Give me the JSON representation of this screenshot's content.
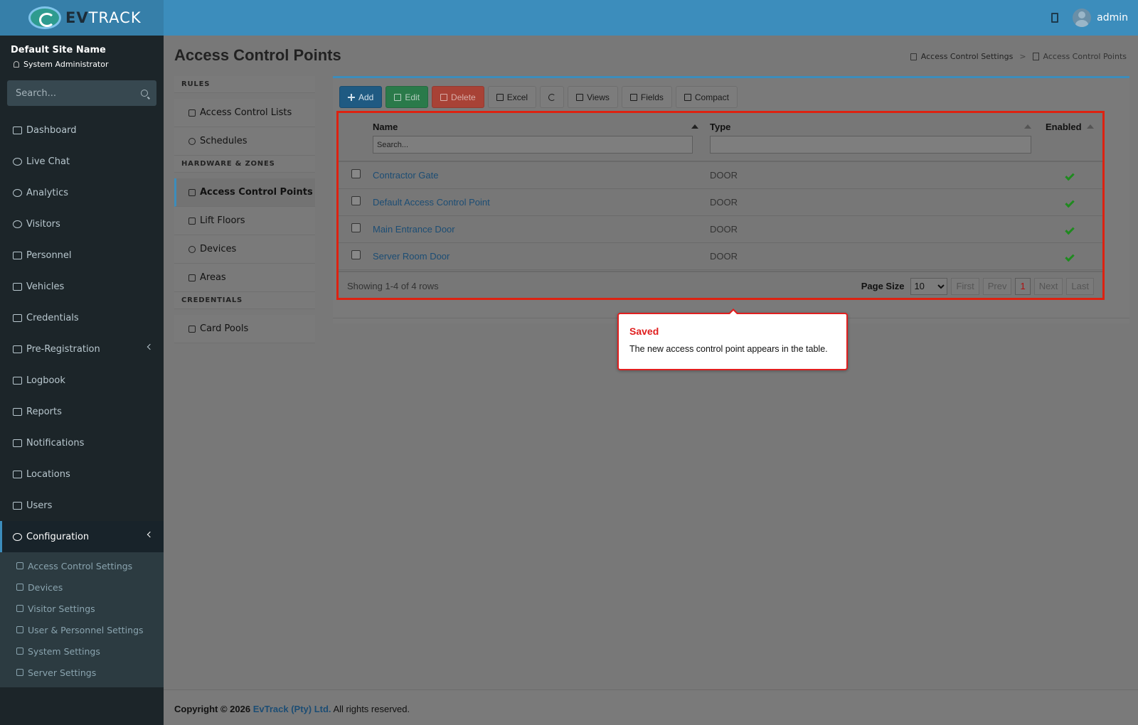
{
  "header": {
    "brand_ev": "EV",
    "brand_track": "TRACK",
    "user": "admin"
  },
  "sidebar": {
    "site_name": "Default Site Name",
    "role": "System Administrator",
    "search_placeholder": "Search...",
    "items": [
      {
        "label": "Dashboard",
        "icon": "dashboard-icon"
      },
      {
        "label": "Live Chat",
        "icon": "headset-icon"
      },
      {
        "label": "Analytics",
        "icon": "analytics-icon"
      },
      {
        "label": "Visitors",
        "icon": "eye-icon"
      },
      {
        "label": "Personnel",
        "icon": "personnel-icon"
      },
      {
        "label": "Vehicles",
        "icon": "car-icon"
      },
      {
        "label": "Credentials",
        "icon": "id-card-icon"
      },
      {
        "label": "Pre-Registration",
        "icon": "exchange-icon"
      },
      {
        "label": "Logbook",
        "icon": "book-icon"
      },
      {
        "label": "Reports",
        "icon": "chart-icon"
      },
      {
        "label": "Notifications",
        "icon": "bell-icon"
      },
      {
        "label": "Locations",
        "icon": "building-icon"
      },
      {
        "label": "Users",
        "icon": "users-icon"
      },
      {
        "label": "Configuration",
        "icon": "gear-icon"
      }
    ],
    "submenu": [
      {
        "label": "Access Control Settings",
        "icon": "lock-icon"
      },
      {
        "label": "Devices",
        "icon": "chip-icon"
      },
      {
        "label": "Visitor Settings",
        "icon": "eye-icon"
      },
      {
        "label": "User & Personnel Settings",
        "icon": "user-cog-icon"
      },
      {
        "label": "System Settings",
        "icon": "sliders-icon"
      },
      {
        "label": "Server Settings",
        "icon": "server-icon"
      }
    ]
  },
  "page": {
    "title": "Access Control Points",
    "breadcrumb": [
      "Access Control Settings",
      "Access Control Points"
    ]
  },
  "subnav": {
    "sections": [
      {
        "header": "RULES",
        "items": [
          "Access Control Lists",
          "Schedules"
        ]
      },
      {
        "header": "HARDWARE & ZONES",
        "items": [
          "Access Control Points",
          "Lift Floors",
          "Devices",
          "Areas"
        ]
      },
      {
        "header": "CREDENTIALS",
        "items": [
          "Card Pools"
        ]
      }
    ]
  },
  "toolbar": {
    "add": "Add",
    "edit": "Edit",
    "delete": "Delete",
    "excel": "Excel",
    "views": "Views",
    "fields": "Fields",
    "compact": "Compact"
  },
  "table": {
    "columns": [
      "Name",
      "Type",
      "Enabled"
    ],
    "name_filter_placeholder": "Search...",
    "rows": [
      {
        "name": "Contractor Gate",
        "type": "DOOR",
        "enabled": true
      },
      {
        "name": "Default Access Control Point",
        "type": "DOOR",
        "enabled": true
      },
      {
        "name": "Main Entrance Door",
        "type": "DOOR",
        "enabled": true
      },
      {
        "name": "Server Room Door",
        "type": "DOOR",
        "enabled": true
      }
    ],
    "showing": "Showing 1-4 of 4 rows",
    "page_size_label": "Page Size",
    "page_size": "10",
    "first": "First",
    "prev": "Prev",
    "current_page": "1",
    "next": "Next",
    "last": "Last"
  },
  "callout": {
    "title": "Saved",
    "text": "The new access control point appears in the table."
  },
  "footer": {
    "prefix": "Copyright © 2026",
    "company": "EvTrack (Pty) Ltd.",
    "suffix": "All rights reserved."
  }
}
